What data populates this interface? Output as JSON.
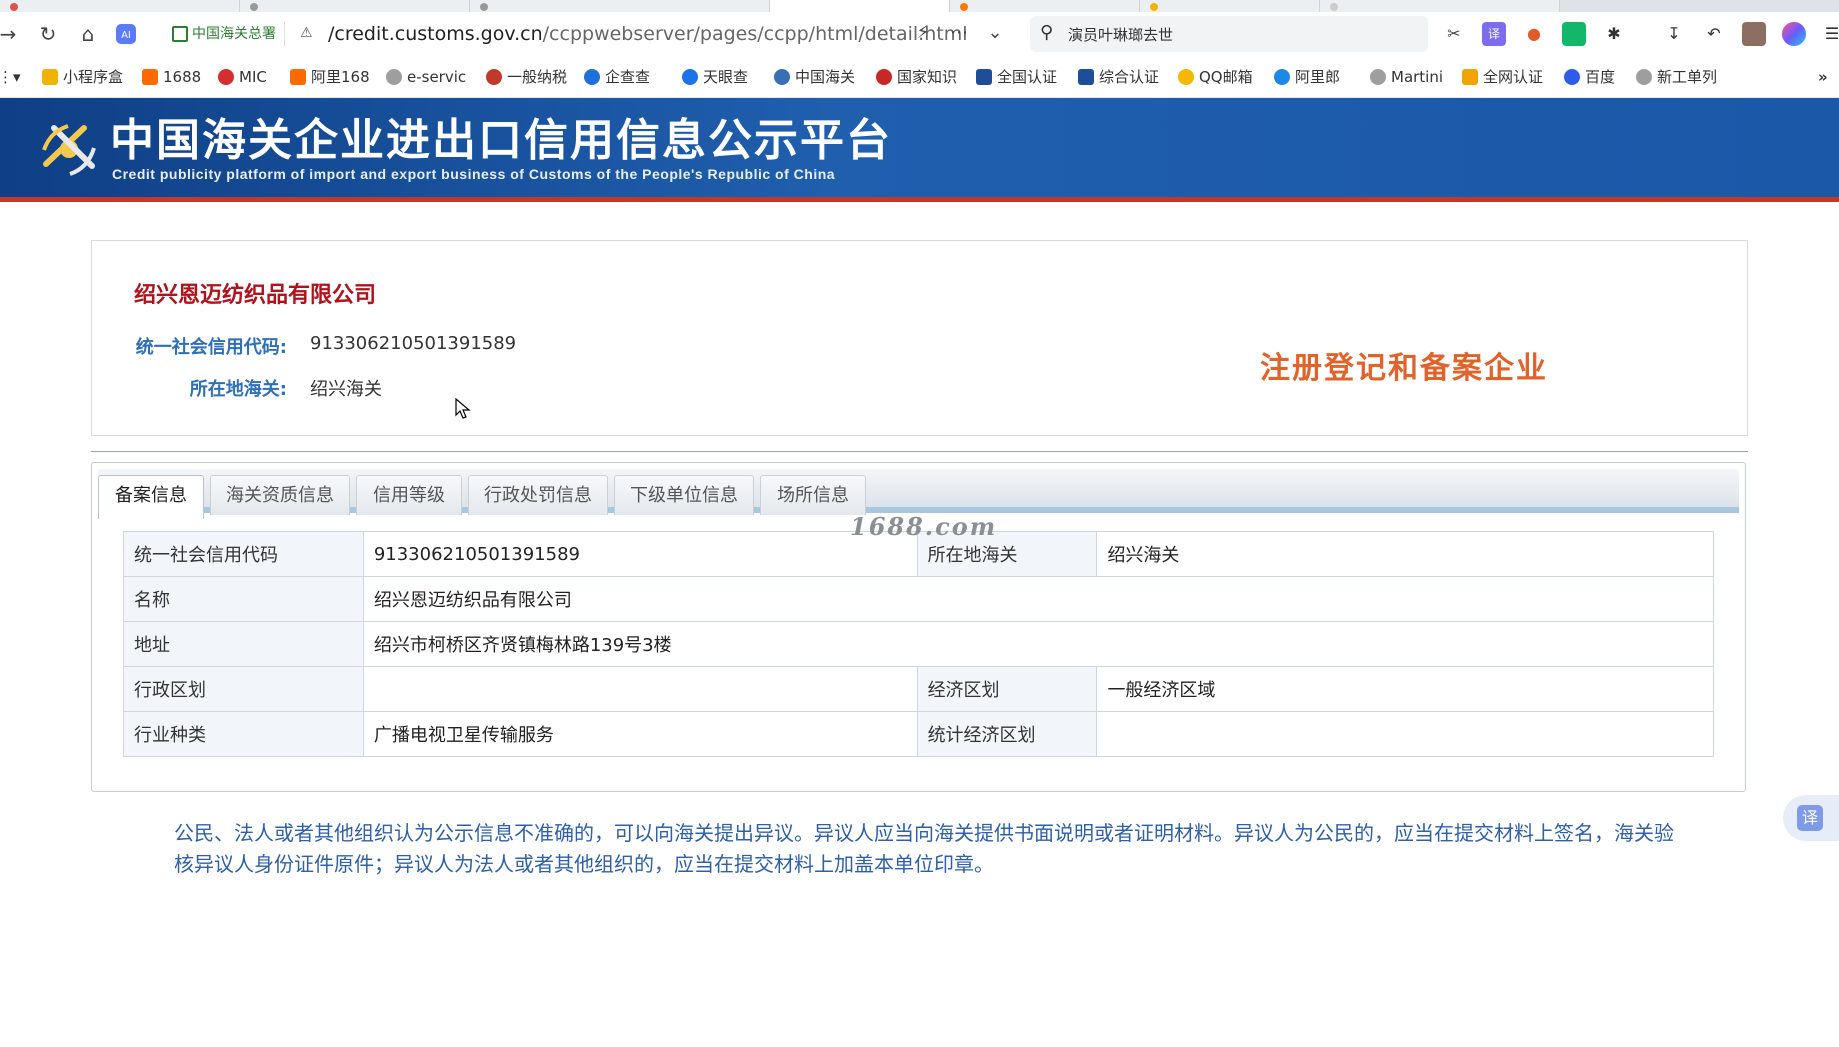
{
  "browser": {
    "address": {
      "site_chip": "中国海关总署",
      "url_host": "/credit.customs.gov.cn",
      "url_path": "/ccppwebserver/pages/ccpp/html/detail.html"
    },
    "search": {
      "query": "演员叶琳瑯去世"
    },
    "bookmarks": [
      {
        "label": "小程序盒",
        "color": "#f0b400"
      },
      {
        "label": "1688",
        "color": "#ff6a00"
      },
      {
        "label": "MIC",
        "color": "#d32f2f"
      },
      {
        "label": "阿里168",
        "color": "#ff6a00"
      },
      {
        "label": "e-servic",
        "color": "#9e9e9e"
      },
      {
        "label": "一般纳税",
        "color": "#c0392b"
      },
      {
        "label": "企查查",
        "color": "#1e6fd9"
      },
      {
        "label": "天眼查",
        "color": "#1a73e8"
      },
      {
        "label": "中国海关",
        "color": "#3a6fb5"
      },
      {
        "label": "国家知识",
        "color": "#c62828"
      },
      {
        "label": "全国认证",
        "color": "#1f4e99"
      },
      {
        "label": "综合认证",
        "color": "#1f4e99"
      },
      {
        "label": "QQ邮箱",
        "color": "#f5b800"
      },
      {
        "label": "阿里郎",
        "color": "#1e88e5"
      },
      {
        "label": "Martini",
        "color": "#9e9e9e"
      },
      {
        "label": "全网认证",
        "color": "#f0a500"
      },
      {
        "label": "百度",
        "color": "#2f5bea"
      },
      {
        "label": "新工单列",
        "color": "#9e9e9e"
      }
    ]
  },
  "header": {
    "title": "中国海关企业进出口信用信息公示平台",
    "subtitle": "Credit publicity platform of import and export business of Customs of the People's Republic of China"
  },
  "company": {
    "name": "绍兴恩迈纺织品有限公司",
    "credit_code_label": "统一社会信用代码:",
    "credit_code": "913306210501391589",
    "customs_label": "所在地海关:",
    "customs": "绍兴海关",
    "status_stamp": "注册登记和备案企业"
  },
  "tabs": [
    {
      "label": "备案信息",
      "active": true
    },
    {
      "label": "海关资质信息",
      "active": false
    },
    {
      "label": "信用等级",
      "active": false
    },
    {
      "label": "行政处罚信息",
      "active": false
    },
    {
      "label": "下级单位信息",
      "active": false
    },
    {
      "label": "场所信息",
      "active": false
    }
  ],
  "watermark": "1688.com",
  "record_table": {
    "rows": [
      [
        "统一社会信用代码",
        "913306210501391589",
        "所在地海关",
        "绍兴海关"
      ],
      [
        "名称",
        "绍兴恩迈纺织品有限公司"
      ],
      [
        "地址",
        "绍兴市柯桥区齐贤镇梅林路139号3楼"
      ],
      [
        "行政区划",
        "",
        "经济区划",
        "一般经济区域"
      ],
      [
        "行业种类",
        "广播电视卫星传输服务",
        "统计经济区划",
        ""
      ]
    ]
  },
  "notice": "公民、法人或者其他组织认为公示信息不准确的，可以向海关提出异议。异议人应当向海关提供书面说明或者证明材料。异议人为公民的，应当在提交材料上签名，海关验核异议人身份证件原件；异议人为法人或者其他组织的，应当在提交材料上加盖本单位印章。",
  "translate_button": "译"
}
